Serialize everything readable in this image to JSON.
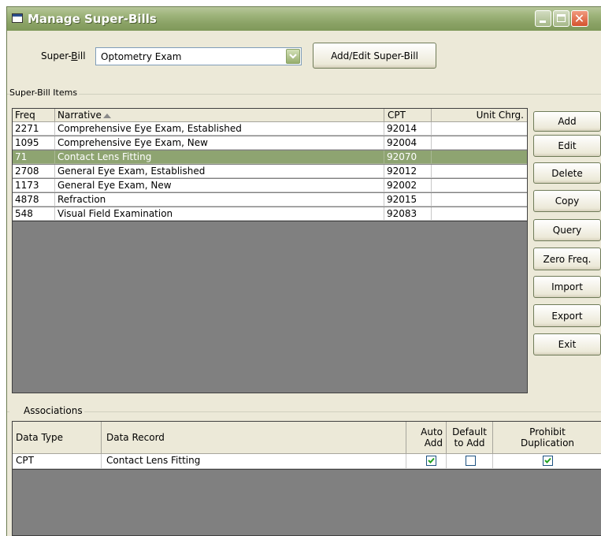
{
  "window": {
    "title": "Manage Super-Bills"
  },
  "superbill": {
    "label": "Super-Bill",
    "selected": "Optometry Exam",
    "add_edit_label": "Add/Edit Super-Bill"
  },
  "items": {
    "group_label": "Super-Bill Items",
    "headers": {
      "freq": "Freq",
      "narrative": "Narrative",
      "cpt": "CPT",
      "unit_chrg": "Unit Chrg."
    },
    "rows": [
      {
        "freq": "2271",
        "narrative": "Comprehensive Eye Exam, Established",
        "cpt": "92014",
        "unit_chrg": ""
      },
      {
        "freq": "1095",
        "narrative": "Comprehensive Eye Exam, New",
        "cpt": "92004",
        "unit_chrg": ""
      },
      {
        "freq": "71",
        "narrative": "Contact Lens Fitting",
        "cpt": "92070",
        "unit_chrg": ""
      },
      {
        "freq": "2708",
        "narrative": "General Eye Exam, Established",
        "cpt": "92012",
        "unit_chrg": ""
      },
      {
        "freq": "1173",
        "narrative": "General Eye Exam, New",
        "cpt": "92002",
        "unit_chrg": ""
      },
      {
        "freq": "4878",
        "narrative": "Refraction",
        "cpt": "92015",
        "unit_chrg": ""
      },
      {
        "freq": "548",
        "narrative": "Visual Field Examination",
        "cpt": "92083",
        "unit_chrg": ""
      }
    ],
    "selected_row": 2
  },
  "buttons": {
    "add": "Add",
    "edit": "Edit",
    "delete": "Delete",
    "copy": "Copy",
    "query": "Query",
    "zero_freq": "Zero Freq.",
    "import": "Import",
    "export": "Export",
    "exit": "Exit"
  },
  "associations": {
    "group_label": "Associations",
    "headers": {
      "data_type": "Data Type",
      "data_record": "Data Record",
      "auto_add_1": "Auto",
      "auto_add_2": "Add",
      "default_add_1": "Default",
      "default_add_2": "to Add",
      "prohibit_dup_1": "Prohibit",
      "prohibit_dup_2": "Duplication"
    },
    "rows": [
      {
        "data_type": "CPT",
        "data_record": "Contact Lens Fitting",
        "auto_add": true,
        "default_to_add": false,
        "prohibit_duplication": true
      }
    ]
  },
  "colors": {
    "titlebar": "#8aa265",
    "selection": "#8ea471",
    "dialog": "#ece9d8"
  }
}
